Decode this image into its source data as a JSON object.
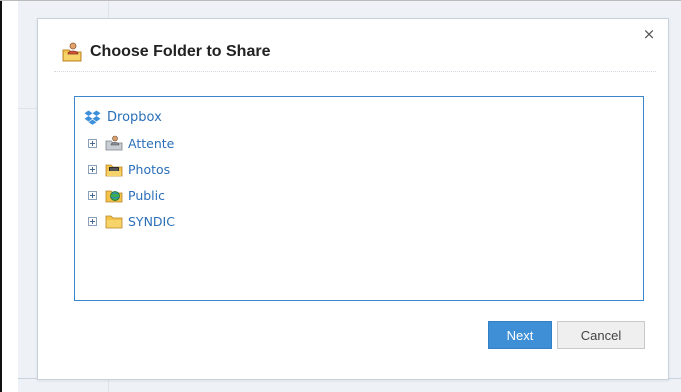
{
  "dialog": {
    "title": "Choose Folder to Share",
    "close_label": "×"
  },
  "tree": {
    "root": {
      "label": "Dropbox",
      "icon": "dropbox-icon"
    },
    "items": [
      {
        "label": "Attente",
        "icon": "shared-folder-icon"
      },
      {
        "label": "Photos",
        "icon": "photos-folder-icon"
      },
      {
        "label": "Public",
        "icon": "public-folder-icon"
      },
      {
        "label": "SYNDIC",
        "icon": "folder-icon"
      }
    ]
  },
  "buttons": {
    "next": "Next",
    "cancel": "Cancel"
  },
  "colors": {
    "accent": "#3f8fd6",
    "link": "#2a6fb8",
    "tree_border": "#3b86c8"
  }
}
